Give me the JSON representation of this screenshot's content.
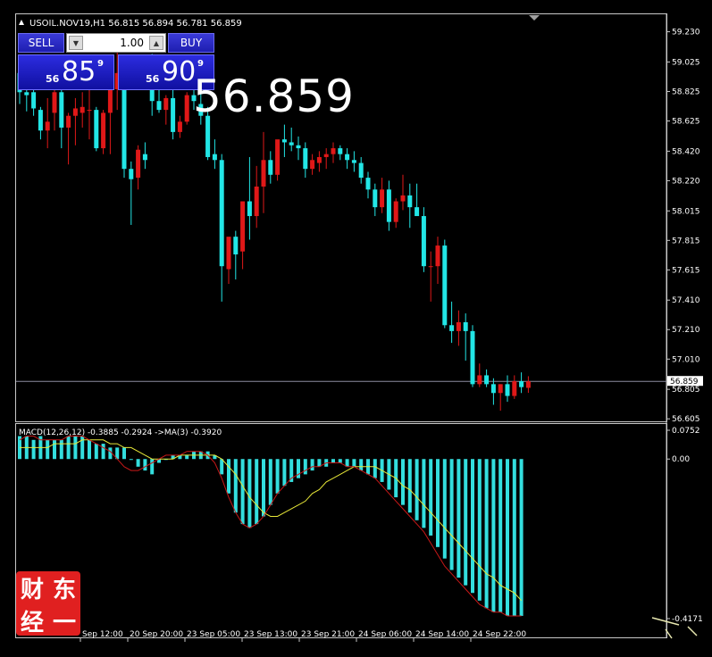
{
  "window": {
    "symbol_line": "USOIL.NOV19,H1  56.815 56.894 56.781 56.859"
  },
  "trade_panel": {
    "sell_label": "SELL",
    "buy_label": "BUY",
    "lot_value": "1.00",
    "bid": {
      "small": "56",
      "big": "85",
      "sup": "9"
    },
    "ask": {
      "small": "56",
      "big": "90",
      "sup": "9"
    }
  },
  "big_price": "56.859",
  "colors": {
    "background": "#000000",
    "bull_candle": "#e01818",
    "bear_candle": "#22e6e6",
    "macd_hist": "#33dede",
    "signal_line": "#e8e838",
    "red_line": "#c81818",
    "current_price_line": "#8c8ca0"
  },
  "chart_data": [
    {
      "type": "candlestick",
      "symbol": "USOIL.NOV19",
      "timeframe": "H1",
      "ohlc_readout": {
        "open": 56.815,
        "high": 56.894,
        "low": 56.781,
        "close": 56.859
      },
      "current_price_label": "56.859",
      "y_tick_labels": [
        "59.230",
        "59.025",
        "58.825",
        "58.625",
        "58.420",
        "58.220",
        "58.015",
        "57.815",
        "57.615",
        "57.410",
        "57.210",
        "57.010",
        "56.805",
        "56.605"
      ],
      "ylim": [
        56.6,
        59.3
      ],
      "candles": [
        {
          "o": 58.95,
          "h": 59.06,
          "l": 58.74,
          "c": 58.82
        },
        {
          "o": 58.82,
          "h": 58.92,
          "l": 58.69,
          "c": 58.8
        },
        {
          "o": 58.82,
          "h": 58.9,
          "l": 58.66,
          "c": 58.71
        },
        {
          "o": 58.7,
          "h": 58.72,
          "l": 58.5,
          "c": 58.56
        },
        {
          "o": 58.56,
          "h": 58.78,
          "l": 58.44,
          "c": 58.62
        },
        {
          "o": 58.68,
          "h": 58.88,
          "l": 58.56,
          "c": 58.82
        },
        {
          "o": 58.82,
          "h": 58.88,
          "l": 58.44,
          "c": 58.58
        },
        {
          "o": 58.58,
          "h": 58.68,
          "l": 58.33,
          "c": 58.66
        },
        {
          "o": 58.66,
          "h": 58.78,
          "l": 58.46,
          "c": 58.71
        },
        {
          "o": 58.68,
          "h": 58.82,
          "l": 58.58,
          "c": 58.72
        },
        {
          "o": 58.7,
          "h": 58.85,
          "l": 58.5,
          "c": 58.7
        },
        {
          "o": 58.7,
          "h": 58.72,
          "l": 58.42,
          "c": 58.44
        },
        {
          "o": 58.44,
          "h": 58.7,
          "l": 58.4,
          "c": 58.68
        },
        {
          "o": 58.68,
          "h": 58.8,
          "l": 58.4,
          "c": 58.84
        },
        {
          "o": 58.84,
          "h": 59.1,
          "l": 58.7,
          "c": 58.95
        },
        {
          "o": 58.95,
          "h": 58.98,
          "l": 58.24,
          "c": 58.3
        },
        {
          "o": 58.3,
          "h": 58.35,
          "l": 57.92,
          "c": 58.23
        },
        {
          "o": 58.24,
          "h": 58.46,
          "l": 58.16,
          "c": 58.43
        },
        {
          "o": 58.4,
          "h": 58.48,
          "l": 58.3,
          "c": 58.36
        },
        {
          "o": 58.98,
          "h": 59.08,
          "l": 58.66,
          "c": 58.76
        },
        {
          "o": 58.76,
          "h": 58.86,
          "l": 58.68,
          "c": 58.7
        },
        {
          "o": 58.7,
          "h": 58.8,
          "l": 58.6,
          "c": 58.78
        },
        {
          "o": 58.78,
          "h": 58.9,
          "l": 58.5,
          "c": 58.55
        },
        {
          "o": 58.55,
          "h": 58.66,
          "l": 58.51,
          "c": 58.62
        },
        {
          "o": 58.62,
          "h": 58.82,
          "l": 58.6,
          "c": 58.8
        },
        {
          "o": 58.8,
          "h": 58.86,
          "l": 58.7,
          "c": 58.76
        },
        {
          "o": 58.74,
          "h": 58.82,
          "l": 58.6,
          "c": 58.66
        },
        {
          "o": 58.66,
          "h": 58.72,
          "l": 58.36,
          "c": 58.38
        },
        {
          "o": 58.4,
          "h": 58.5,
          "l": 58.3,
          "c": 58.36
        },
        {
          "o": 58.36,
          "h": 58.4,
          "l": 57.4,
          "c": 57.64
        },
        {
          "o": 57.62,
          "h": 57.82,
          "l": 57.52,
          "c": 57.84
        },
        {
          "o": 57.84,
          "h": 57.88,
          "l": 57.55,
          "c": 57.72
        },
        {
          "o": 57.74,
          "h": 58.08,
          "l": 57.62,
          "c": 58.08
        },
        {
          "o": 58.08,
          "h": 58.38,
          "l": 57.82,
          "c": 57.98
        },
        {
          "o": 57.98,
          "h": 58.32,
          "l": 57.9,
          "c": 58.18
        },
        {
          "o": 58.18,
          "h": 58.55,
          "l": 58.0,
          "c": 58.36
        },
        {
          "o": 58.36,
          "h": 58.42,
          "l": 58.2,
          "c": 58.26
        },
        {
          "o": 58.26,
          "h": 58.48,
          "l": 58.22,
          "c": 58.5
        },
        {
          "o": 58.5,
          "h": 58.6,
          "l": 58.38,
          "c": 58.48
        },
        {
          "o": 58.48,
          "h": 58.58,
          "l": 58.42,
          "c": 58.46
        },
        {
          "o": 58.46,
          "h": 58.52,
          "l": 58.36,
          "c": 58.44
        },
        {
          "o": 58.44,
          "h": 58.48,
          "l": 58.24,
          "c": 58.3
        },
        {
          "o": 58.3,
          "h": 58.4,
          "l": 58.26,
          "c": 58.36
        },
        {
          "o": 58.34,
          "h": 58.42,
          "l": 58.28,
          "c": 58.38
        },
        {
          "o": 58.38,
          "h": 58.44,
          "l": 58.3,
          "c": 58.4
        },
        {
          "o": 58.4,
          "h": 58.48,
          "l": 58.34,
          "c": 58.44
        },
        {
          "o": 58.44,
          "h": 58.46,
          "l": 58.36,
          "c": 58.4
        },
        {
          "o": 58.4,
          "h": 58.44,
          "l": 58.3,
          "c": 58.36
        },
        {
          "o": 58.36,
          "h": 58.42,
          "l": 58.28,
          "c": 58.34
        },
        {
          "o": 58.34,
          "h": 58.38,
          "l": 58.2,
          "c": 58.24
        },
        {
          "o": 58.24,
          "h": 58.28,
          "l": 58.1,
          "c": 58.16
        },
        {
          "o": 58.16,
          "h": 58.2,
          "l": 57.98,
          "c": 58.04
        },
        {
          "o": 58.04,
          "h": 58.24,
          "l": 58.0,
          "c": 58.16
        },
        {
          "o": 58.16,
          "h": 58.22,
          "l": 57.88,
          "c": 57.94
        },
        {
          "o": 57.94,
          "h": 58.1,
          "l": 57.9,
          "c": 58.08
        },
        {
          "o": 58.08,
          "h": 58.26,
          "l": 58.02,
          "c": 58.12
        },
        {
          "o": 58.12,
          "h": 58.2,
          "l": 57.9,
          "c": 58.04
        },
        {
          "o": 58.04,
          "h": 58.2,
          "l": 58.0,
          "c": 57.98
        },
        {
          "o": 57.98,
          "h": 58.04,
          "l": 57.6,
          "c": 57.64
        },
        {
          "o": 57.64,
          "h": 57.74,
          "l": 57.4,
          "c": 57.64
        },
        {
          "o": 57.64,
          "h": 57.84,
          "l": 57.52,
          "c": 57.78
        },
        {
          "o": 57.78,
          "h": 57.82,
          "l": 57.22,
          "c": 57.24
        },
        {
          "o": 57.24,
          "h": 57.4,
          "l": 57.12,
          "c": 57.2
        },
        {
          "o": 57.2,
          "h": 57.34,
          "l": 57.1,
          "c": 57.26
        },
        {
          "o": 57.26,
          "h": 57.32,
          "l": 57.0,
          "c": 57.2
        },
        {
          "o": 57.2,
          "h": 57.24,
          "l": 56.82,
          "c": 56.84
        },
        {
          "o": 56.84,
          "h": 56.98,
          "l": 56.82,
          "c": 56.9
        },
        {
          "o": 56.9,
          "h": 56.94,
          "l": 56.82,
          "c": 56.84
        },
        {
          "o": 56.84,
          "h": 56.88,
          "l": 56.7,
          "c": 56.78
        },
        {
          "o": 56.78,
          "h": 56.84,
          "l": 56.66,
          "c": 56.84
        },
        {
          "o": 56.84,
          "h": 56.9,
          "l": 56.72,
          "c": 56.76
        },
        {
          "o": 56.76,
          "h": 56.9,
          "l": 56.74,
          "c": 56.86
        },
        {
          "o": 56.86,
          "h": 56.92,
          "l": 56.78,
          "c": 56.82
        },
        {
          "o": 56.815,
          "h": 56.894,
          "l": 56.781,
          "c": 56.859
        }
      ]
    },
    {
      "type": "bar",
      "indicator_label": "MACD(12,26,12) -0.3885 -0.2924  ->MA(3) -0.3920",
      "y_tick_labels": [
        "0.0752",
        "0.00",
        "-0.4171"
      ],
      "ylim": [
        -0.4171,
        0.0752
      ],
      "histogram": [
        0.06,
        0.06,
        0.05,
        0.06,
        0.05,
        0.05,
        0.05,
        0.06,
        0.06,
        0.06,
        0.05,
        0.04,
        0.04,
        0.03,
        0.03,
        0.03,
        0.0,
        -0.02,
        -0.03,
        -0.04,
        -0.01,
        0.0,
        0.01,
        0.01,
        0.01,
        0.02,
        0.02,
        0.02,
        0.01,
        -0.04,
        -0.09,
        -0.14,
        -0.17,
        -0.18,
        -0.17,
        -0.15,
        -0.12,
        -0.09,
        -0.07,
        -0.06,
        -0.05,
        -0.04,
        -0.03,
        -0.02,
        -0.02,
        -0.01,
        -0.01,
        -0.02,
        -0.02,
        -0.03,
        -0.04,
        -0.05,
        -0.06,
        -0.08,
        -0.1,
        -0.12,
        -0.14,
        -0.16,
        -0.18,
        -0.2,
        -0.23,
        -0.26,
        -0.29,
        -0.31,
        -0.33,
        -0.35,
        -0.37,
        -0.39,
        -0.4,
        -0.4,
        -0.41,
        -0.41,
        -0.41
      ],
      "signal": [
        0.03,
        0.03,
        0.03,
        0.03,
        0.03,
        0.04,
        0.04,
        0.04,
        0.04,
        0.05,
        0.05,
        0.05,
        0.05,
        0.04,
        0.04,
        0.03,
        0.03,
        0.02,
        0.01,
        0.0,
        0.0,
        0.0,
        0.0,
        0.01,
        0.01,
        0.01,
        0.01,
        0.01,
        0.01,
        0.0,
        -0.02,
        -0.04,
        -0.07,
        -0.1,
        -0.12,
        -0.14,
        -0.15,
        -0.15,
        -0.14,
        -0.13,
        -0.12,
        -0.11,
        -0.09,
        -0.08,
        -0.06,
        -0.05,
        -0.04,
        -0.03,
        -0.02,
        -0.02,
        -0.02,
        -0.02,
        -0.03,
        -0.04,
        -0.05,
        -0.07,
        -0.08,
        -0.1,
        -0.12,
        -0.14,
        -0.16,
        -0.18,
        -0.2,
        -0.22,
        -0.24,
        -0.26,
        -0.28,
        -0.3,
        -0.31,
        -0.33,
        -0.34,
        -0.35,
        -0.37
      ],
      "ma": [
        0.05,
        0.06,
        0.06,
        0.05,
        0.05,
        0.05,
        0.05,
        0.06,
        0.06,
        0.06,
        0.05,
        0.04,
        0.03,
        0.02,
        0.0,
        -0.02,
        -0.03,
        -0.03,
        -0.02,
        -0.01,
        0.0,
        0.01,
        0.01,
        0.01,
        0.02,
        0.02,
        0.02,
        0.01,
        -0.01,
        -0.05,
        -0.1,
        -0.14,
        -0.17,
        -0.18,
        -0.17,
        -0.15,
        -0.12,
        -0.09,
        -0.07,
        -0.05,
        -0.04,
        -0.03,
        -0.02,
        -0.02,
        -0.01,
        -0.01,
        -0.01,
        -0.02,
        -0.02,
        -0.03,
        -0.04,
        -0.05,
        -0.07,
        -0.09,
        -0.11,
        -0.13,
        -0.15,
        -0.17,
        -0.19,
        -0.22,
        -0.25,
        -0.28,
        -0.3,
        -0.32,
        -0.34,
        -0.36,
        -0.38,
        -0.39,
        -0.4,
        -0.4,
        -0.41,
        -0.41,
        -0.41
      ]
    }
  ],
  "x_axis_labels": [
    "Sep 12:00",
    "20 Sep 20:00",
    "23 Sep 05:00",
    "23 Sep 13:00",
    "23 Sep 21:00",
    "24 Sep 06:00",
    "24 Sep 14:00",
    "24 Sep 22:00"
  ],
  "logo_chars": [
    "财",
    "东",
    "经",
    "一"
  ]
}
